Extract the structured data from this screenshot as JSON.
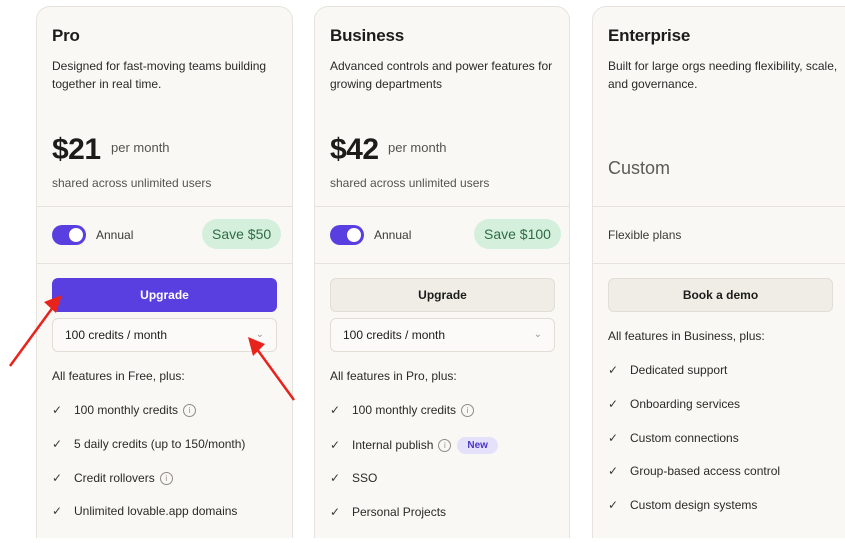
{
  "plans": [
    {
      "name": "Pro",
      "description": "Designed for fast-moving teams building together in real time.",
      "price": "$21",
      "period": "per month",
      "shared": "shared across unlimited users",
      "toggle_label": "Annual",
      "save_badge": "Save $50",
      "button": "Upgrade",
      "credits": "100 credits / month",
      "features_heading": "All features in Free, plus:",
      "features": [
        {
          "text": "100 monthly credits",
          "info": true
        },
        {
          "text": "5 daily credits (up to 150/month)"
        },
        {
          "text": "Credit rollovers",
          "info": true
        },
        {
          "text": "Unlimited lovable.app domains"
        }
      ]
    },
    {
      "name": "Business",
      "description": "Advanced controls and power features for growing departments",
      "price": "$42",
      "period": "per month",
      "shared": "shared across unlimited users",
      "toggle_label": "Annual",
      "save_badge": "Save $100",
      "button": "Upgrade",
      "credits": "100 credits / month",
      "features_heading": "All features in Pro, plus:",
      "features": [
        {
          "text": "100 monthly credits",
          "info": true
        },
        {
          "text": "Internal publish",
          "info": true,
          "badge": "New"
        },
        {
          "text": "SSO"
        },
        {
          "text": "Personal Projects"
        }
      ]
    },
    {
      "name": "Enterprise",
      "description": "Built for large orgs needing flexibility, scale, and governance.",
      "price_custom": "Custom",
      "flexible": "Flexible plans",
      "button": "Book a demo",
      "features_heading": "All features in Business, plus:",
      "features": [
        {
          "text": "Dedicated support"
        },
        {
          "text": "Onboarding services"
        },
        {
          "text": "Custom connections"
        },
        {
          "text": "Group-based access control"
        },
        {
          "text": "Custom design systems"
        }
      ]
    }
  ],
  "icons": {
    "check": "check-icon",
    "info": "info-icon",
    "chevron": "chevron-down-icon",
    "annotation_arrow": "red-arrow"
  },
  "colors": {
    "accent": "#5a3fe0",
    "save_badge_bg": "#d4f0dc",
    "save_badge_text": "#2f6b45",
    "new_badge_bg": "#e6e1fb",
    "card_bg": "#f9f8f5",
    "annotation": "#e8231b"
  }
}
